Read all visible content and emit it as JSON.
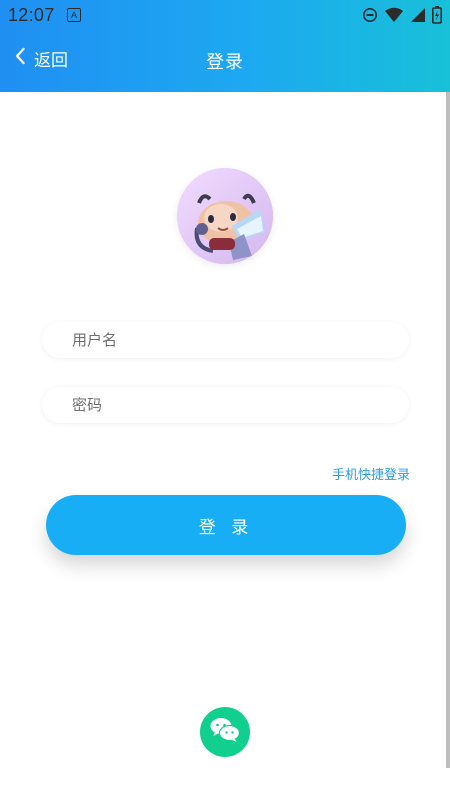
{
  "status_bar": {
    "time": "12:07",
    "notification_icon": "A"
  },
  "nav": {
    "back_label": "返回",
    "title": "登录"
  },
  "form": {
    "username_placeholder": "用户名",
    "password_placeholder": "密码",
    "quick_login_label": "手机快捷登录",
    "login_button_label": "登 录"
  },
  "social": {
    "wechat_icon": "wechat-icon"
  },
  "colors": {
    "primary": "#18aef5",
    "header_start": "#1f8ff2",
    "header_end": "#18c0d8",
    "wechat": "#11d08f",
    "link": "#2d9fe0"
  }
}
